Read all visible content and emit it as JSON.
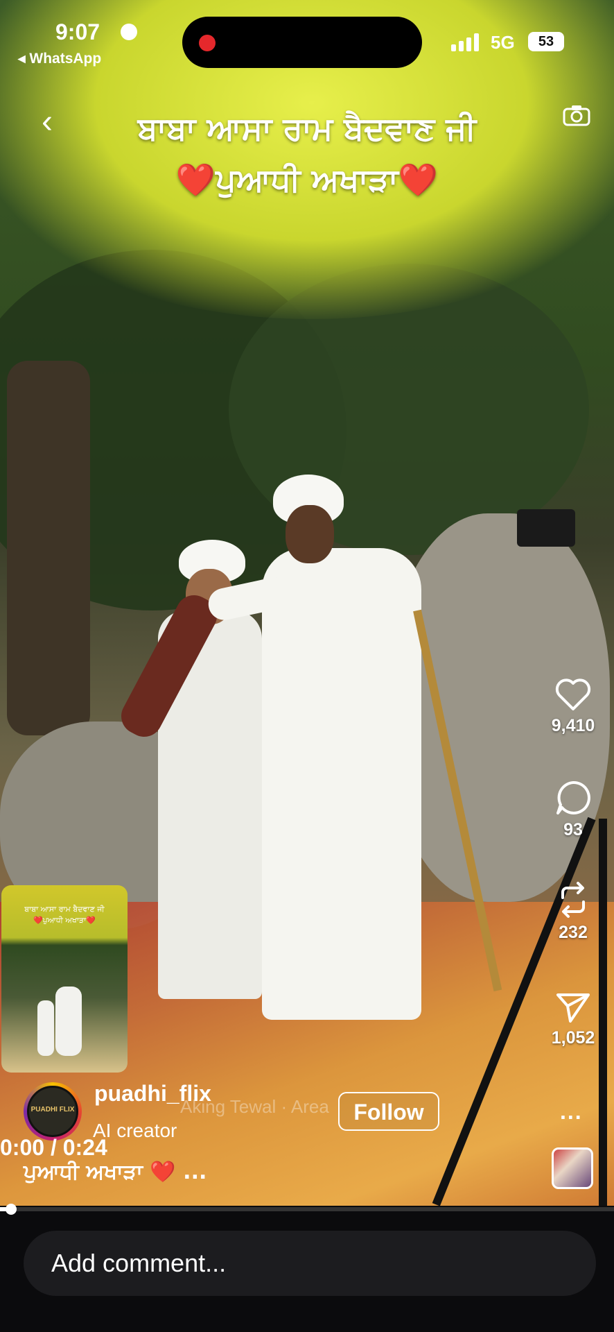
{
  "status_bar": {
    "time": "9:07",
    "back_app": "◂ WhatsApp",
    "network": "5G",
    "battery": "53"
  },
  "reel": {
    "title_line1": "ਬਾਬਾ ਆਸਾ ਰਾਮ ਬੈਦਵਾਣ ਜੀ",
    "title_line2": "❤️ਪੁਆਧੀ ਅਖਾੜਾ❤️",
    "pip_title_line1": "ਬਾਬਾ ਆਸਾ ਰਾਮ ਬੈਦਵਾਣ ਜੀ",
    "pip_title_line2": "❤️ਪੁਆਧੀ ਅਖਾੜਾ❤️"
  },
  "actions": {
    "likes": "9,410",
    "comments": "93",
    "reposts": "232",
    "shares": "1,052",
    "more": "..."
  },
  "creator": {
    "username": "puadhi_flix",
    "avatar_text": "PUADHI FLIX",
    "label": "AI creator",
    "location_ghost": "Aking Tewal · Area",
    "follow_label": "Follow"
  },
  "playback": {
    "timecode": "0:00 / 0:24",
    "progress": 0.01
  },
  "caption": {
    "text": "ਪੁਆਧੀ ਅਖਾੜਾ ❤️ ..."
  },
  "comment": {
    "placeholder": "Add comment..."
  },
  "colors": {
    "heart_red": "#e5282c",
    "canopy_yellow": "#d6df35",
    "bar_bg": "#0b0b0d"
  }
}
